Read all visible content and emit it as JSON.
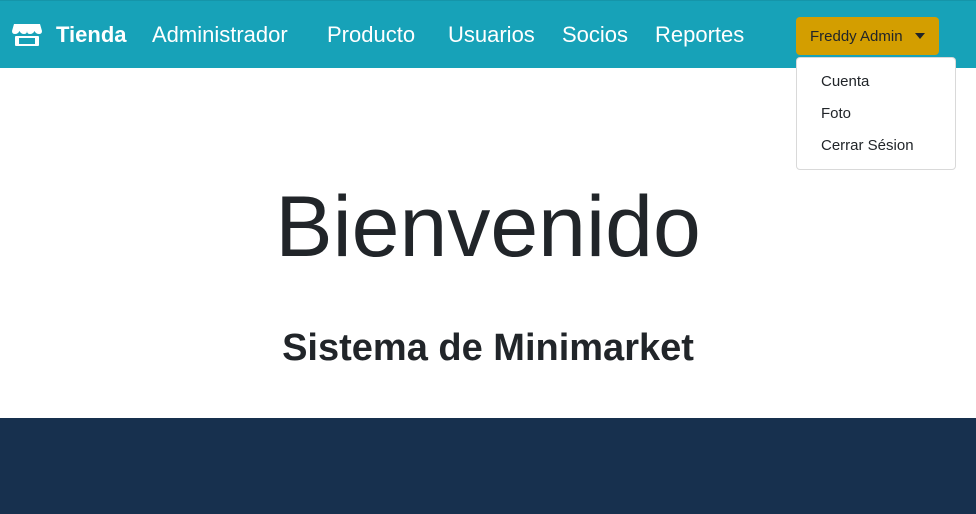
{
  "navbar": {
    "brand_label": "Tienda",
    "brand_icon": "store-icon",
    "links": [
      "Administrador",
      "Producto",
      "Usuarios",
      "Socios",
      "Reportes"
    ]
  },
  "user_menu": {
    "button_label": "Freddy Admin",
    "items": [
      "Cuenta",
      "Foto",
      "Cerrar Sésion"
    ]
  },
  "hero": {
    "title": "Bienvenido",
    "subtitle": "Sistema de Minimarket"
  },
  "colors": {
    "navbar": "#17a2b8",
    "user_button": "#d39e00",
    "footer": "#17304e"
  }
}
